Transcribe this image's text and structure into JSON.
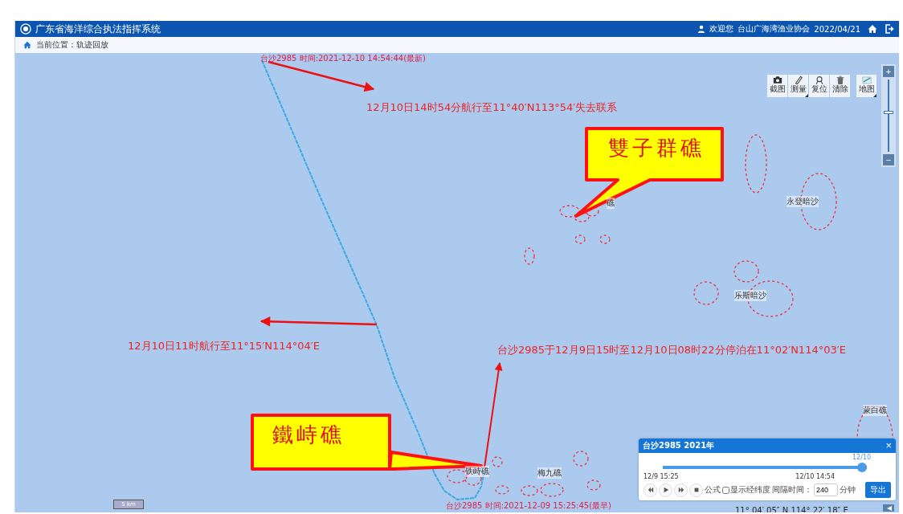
{
  "header": {
    "title": "广东省海洋综合执法指挥系统",
    "welcome": "欢迎您",
    "organization": "台山广海湾渔业协会",
    "date": "2022/04/21"
  },
  "breadcrumb": {
    "label": "当前位置：轨迹回放"
  },
  "toolbar": [
    {
      "label": "截图",
      "kind": "camera",
      "dropdown": false
    },
    {
      "label": "测量",
      "kind": "ruler",
      "dropdown": true
    },
    {
      "label": "复位",
      "kind": "locate",
      "dropdown": false
    },
    {
      "label": "清除",
      "kind": "trash",
      "dropdown": false
    }
  ],
  "map_button": {
    "label": "地图",
    "dropdown": true
  },
  "zoom": {
    "zoom_in": "+",
    "zoom_out": "−",
    "level": 0.55
  },
  "track_labels": [
    {
      "text": "台沙2985 时间:2021-12-10 14:54:44(最新)",
      "kind": "end"
    },
    {
      "text": "台沙2985 时间:2021-12-09 15:25:45(最早)",
      "kind": "start"
    }
  ],
  "reef_labels": [
    "礁",
    "永登暗沙",
    "乐斯暗沙",
    "铁峙礁",
    "梅九礁",
    "蒙白礁"
  ],
  "annotations": [
    "12月10日14时54分航行至11°40′N113°54′失去联系",
    "12月10日11时航行至11°15′N114°04′E",
    "台沙2985于12月9日15时至12月10日08时22分停泊在11°02′N114°03′E"
  ],
  "callouts": [
    "雙子群礁",
    "鐵峙礁"
  ],
  "scale": "5 km",
  "coordinates": "11° 04′ 05″ N 114° 22′ 18″ E",
  "playback": {
    "title": "台沙2985 2021年",
    "close": "×",
    "thumb_label": "12/10",
    "level": 1.0,
    "start_time": "12/9 15:25",
    "end_time": "12/10 14:54",
    "mode": "公式",
    "show_coordinates": {
      "label": "显示经纬度",
      "checked": false
    },
    "interval_label": "间隔时间：",
    "interval": "240",
    "unit": "分钟",
    "export": "导出"
  }
}
